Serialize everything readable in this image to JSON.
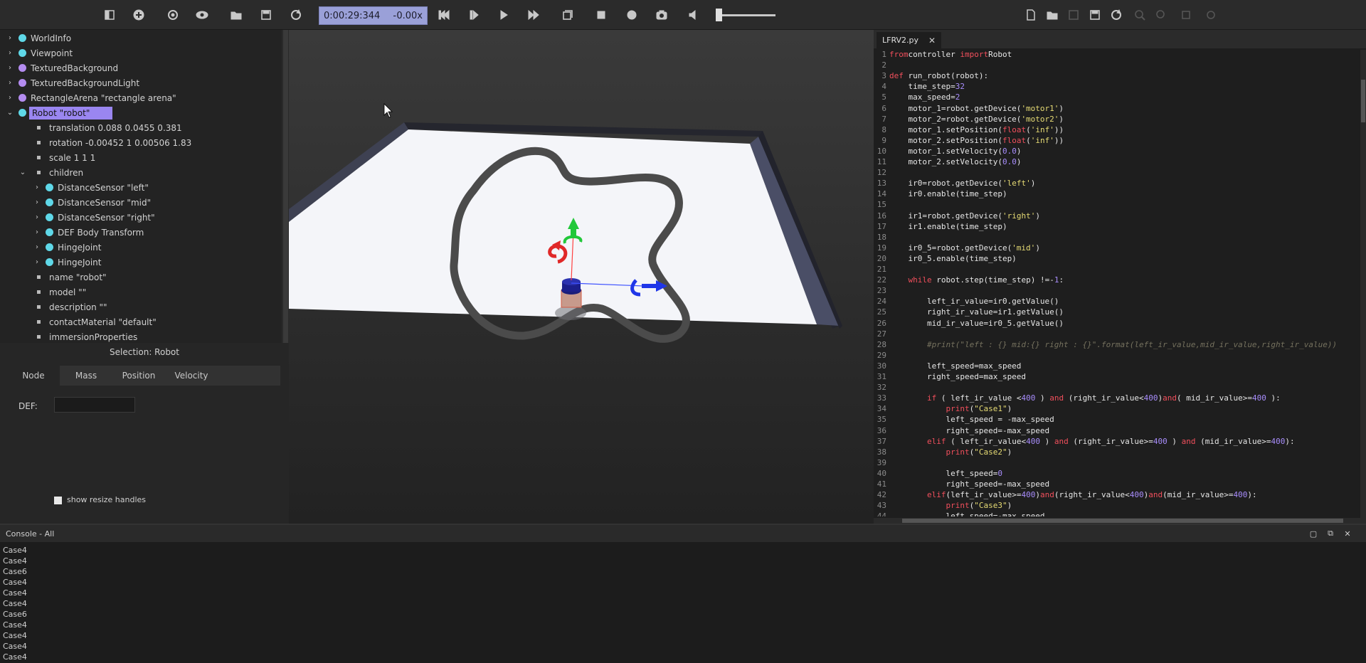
{
  "toolbar": {
    "time": "0:00:29:344",
    "separator": "-",
    "speed": "0.00x",
    "icons_left": [
      "scene-tree-toggle-icon",
      "add-node-icon",
      "reset-view-icon",
      "eye-icon",
      "open-world-icon",
      "save-world-icon",
      "reload-world-icon"
    ],
    "icons_sim": [
      "step-back-icon",
      "step-icon",
      "play-icon",
      "fast-forward-icon",
      "box-view-icon",
      "stop-recording-icon",
      "record-movie-icon",
      "screenshot-icon",
      "mute-icon"
    ],
    "icons_editor": [
      "new-file-icon",
      "open-file-icon",
      "save-file-icon",
      "save-as-icon",
      "revert-file-icon",
      "find-icon",
      "replace-icon",
      "build-icon",
      "clean-icon"
    ]
  },
  "scene_tree": {
    "items": [
      {
        "label": "WorldInfo",
        "depth": 0,
        "marker": "dot-cyan",
        "arrow": "›"
      },
      {
        "label": "Viewpoint",
        "depth": 0,
        "marker": "dot-cyan",
        "arrow": "›"
      },
      {
        "label": "TexturedBackground",
        "depth": 0,
        "marker": "dot-purple",
        "arrow": "›"
      },
      {
        "label": "TexturedBackgroundLight",
        "depth": 0,
        "marker": "dot-purple",
        "arrow": "›"
      },
      {
        "label": "RectangleArena \"rectangle arena\"",
        "depth": 0,
        "marker": "dot-purple",
        "arrow": "›"
      },
      {
        "label": "Robot \"robot\"",
        "depth": 0,
        "marker": "dot-cyan",
        "arrow": "⌄",
        "selected": true
      },
      {
        "label": "translation 0.088 0.0455 0.381",
        "depth": 1,
        "marker": "square",
        "arrow": ""
      },
      {
        "label": "rotation -0.00452 1 0.00506 1.83",
        "depth": 1,
        "marker": "square",
        "arrow": ""
      },
      {
        "label": "scale 1 1 1",
        "depth": 1,
        "marker": "square",
        "arrow": ""
      },
      {
        "label": "children",
        "depth": 1,
        "marker": "square",
        "arrow": "⌄"
      },
      {
        "label": "DistanceSensor \"left\"",
        "depth": 2,
        "marker": "dot-cyan",
        "arrow": "›"
      },
      {
        "label": "DistanceSensor \"mid\"",
        "depth": 2,
        "marker": "dot-cyan",
        "arrow": "›"
      },
      {
        "label": "DistanceSensor \"right\"",
        "depth": 2,
        "marker": "dot-cyan",
        "arrow": "›"
      },
      {
        "label": "DEF Body Transform",
        "depth": 2,
        "marker": "dot-cyan",
        "arrow": "›"
      },
      {
        "label": "HingeJoint",
        "depth": 2,
        "marker": "dot-cyan",
        "arrow": "›"
      },
      {
        "label": "HingeJoint",
        "depth": 2,
        "marker": "dot-cyan",
        "arrow": "›"
      },
      {
        "label": "name \"robot\"",
        "depth": 1,
        "marker": "square",
        "arrow": ""
      },
      {
        "label": "model \"\"",
        "depth": 1,
        "marker": "square",
        "arrow": ""
      },
      {
        "label": "description \"\"",
        "depth": 1,
        "marker": "square",
        "arrow": ""
      },
      {
        "label": "contactMaterial \"default\"",
        "depth": 1,
        "marker": "square",
        "arrow": ""
      },
      {
        "label": "immersionProperties",
        "depth": 1,
        "marker": "square",
        "arrow": ""
      }
    ]
  },
  "node_panel": {
    "selection": "Selection: Robot",
    "tabs": [
      "Node",
      "Mass",
      "Position",
      "Velocity"
    ],
    "active_tab": "Node",
    "def_label": "DEF:",
    "def_value": "",
    "resize_label": "show resize handles"
  },
  "editor": {
    "filename": "LFRV2.py",
    "close": "✕",
    "lines": [
      [
        [
          "kw",
          "from"
        ],
        [
          "",
          "controller "
        ],
        [
          "kw",
          "import"
        ],
        [
          "",
          "Robot"
        ]
      ],
      [],
      [
        [
          "kw",
          "def"
        ],
        [
          "",
          " run_robot(robot):"
        ]
      ],
      [
        [
          "",
          "    time_step="
        ],
        [
          "nm",
          "32"
        ]
      ],
      [
        [
          "",
          "    max_speed="
        ],
        [
          "nm",
          "2"
        ]
      ],
      [
        [
          "",
          "    motor_1=robot.getDevice("
        ],
        [
          "st",
          "'motor1'"
        ],
        [
          "",
          ")"
        ]
      ],
      [
        [
          "",
          "    motor_2=robot.getDevice("
        ],
        [
          "st",
          "'motor2'"
        ],
        [
          "",
          ")"
        ]
      ],
      [
        [
          "",
          "    motor_1.setPosition("
        ],
        [
          "bi",
          "float"
        ],
        [
          "",
          "("
        ],
        [
          "st",
          "'inf'"
        ],
        [
          "",
          "))"
        ]
      ],
      [
        [
          "",
          "    motor_2.setPosition("
        ],
        [
          "bi",
          "float"
        ],
        [
          "",
          "("
        ],
        [
          "st",
          "'inf'"
        ],
        [
          "",
          "))"
        ]
      ],
      [
        [
          "",
          "    motor_1.setVelocity("
        ],
        [
          "nm",
          "0.0"
        ],
        [
          "",
          ")"
        ]
      ],
      [
        [
          "",
          "    motor_2.setVelocity("
        ],
        [
          "nm",
          "0.0"
        ],
        [
          "",
          ")"
        ]
      ],
      [],
      [
        [
          "",
          "    ir0=robot.getDevice("
        ],
        [
          "st",
          "'left'"
        ],
        [
          "",
          ")"
        ]
      ],
      [
        [
          "",
          "    ir0.enable(time_step)"
        ]
      ],
      [],
      [
        [
          "",
          "    ir1=robot.getDevice("
        ],
        [
          "st",
          "'right'"
        ],
        [
          "",
          ")"
        ]
      ],
      [
        [
          "",
          "    ir1.enable(time_step)"
        ]
      ],
      [],
      [
        [
          "",
          "    ir0_5=robot.getDevice("
        ],
        [
          "st",
          "'mid'"
        ],
        [
          "",
          ")"
        ]
      ],
      [
        [
          "",
          "    ir0_5.enable(time_step)"
        ]
      ],
      [],
      [
        [
          "",
          "    "
        ],
        [
          "kw",
          "while"
        ],
        [
          "",
          " robot.step(time_step) !=-"
        ],
        [
          "nm",
          "1"
        ],
        [
          "",
          ":"
        ]
      ],
      [],
      [
        [
          "",
          "        left_ir_value=ir0.getValue()"
        ]
      ],
      [
        [
          "",
          "        right_ir_value=ir1.getValue()"
        ]
      ],
      [
        [
          "",
          "        mid_ir_value=ir0_5.getValue()"
        ]
      ],
      [],
      [
        [
          "cm",
          "        #print(\"left : {} mid:{} right : {}\".format(left_ir_value,mid_ir_value,right_ir_value))"
        ]
      ],
      [],
      [
        [
          "",
          "        left_speed=max_speed"
        ]
      ],
      [
        [
          "",
          "        right_speed=max_speed"
        ]
      ],
      [],
      [
        [
          "",
          "        "
        ],
        [
          "kw",
          "if"
        ],
        [
          "",
          " ( left_ir_value <"
        ],
        [
          "nm",
          "400"
        ],
        [
          "",
          " ) "
        ],
        [
          "kw",
          "and"
        ],
        [
          "",
          " (right_ir_value<"
        ],
        [
          "nm",
          "400"
        ],
        [
          "",
          ")"
        ],
        [
          "kw",
          "and"
        ],
        [
          "",
          "( mid_ir_value>="
        ],
        [
          "nm",
          "400"
        ],
        [
          "",
          " ):"
        ]
      ],
      [
        [
          "",
          "            "
        ],
        [
          "bi",
          "print"
        ],
        [
          "",
          "("
        ],
        [
          "st",
          "\"Case1\""
        ],
        [
          "",
          ")"
        ]
      ],
      [
        [
          "",
          "            left_speed = -max_speed"
        ]
      ],
      [
        [
          "",
          "            right_speed=-max_speed"
        ]
      ],
      [
        [
          "",
          "        "
        ],
        [
          "kw",
          "elif"
        ],
        [
          "",
          " ( left_ir_value<"
        ],
        [
          "nm",
          "400"
        ],
        [
          "",
          " ) "
        ],
        [
          "kw",
          "and"
        ],
        [
          "",
          " (right_ir_value>="
        ],
        [
          "nm",
          "400"
        ],
        [
          "",
          " ) "
        ],
        [
          "kw",
          "and"
        ],
        [
          "",
          " (mid_ir_value>="
        ],
        [
          "nm",
          "400"
        ],
        [
          "",
          "):"
        ]
      ],
      [
        [
          "",
          "            "
        ],
        [
          "bi",
          "print"
        ],
        [
          "",
          "("
        ],
        [
          "st",
          "\"Case2\""
        ],
        [
          "",
          ")"
        ]
      ],
      [],
      [
        [
          "",
          "            left_speed="
        ],
        [
          "nm",
          "0"
        ]
      ],
      [
        [
          "",
          "            right_speed=-max_speed"
        ]
      ],
      [
        [
          "",
          "        "
        ],
        [
          "kw",
          "elif"
        ],
        [
          "",
          "(left_ir_value>="
        ],
        [
          "nm",
          "400"
        ],
        [
          "",
          ")"
        ],
        [
          "kw",
          "and"
        ],
        [
          "",
          "(right_ir_value<"
        ],
        [
          "nm",
          "400"
        ],
        [
          "",
          ")"
        ],
        [
          "kw",
          "and"
        ],
        [
          "",
          "(mid_ir_value>="
        ],
        [
          "nm",
          "400"
        ],
        [
          "",
          "):"
        ]
      ],
      [
        [
          "",
          "            "
        ],
        [
          "bi",
          "print"
        ],
        [
          "",
          "("
        ],
        [
          "st",
          "\"Case3\""
        ],
        [
          "",
          ")"
        ]
      ],
      [
        [
          "",
          "            left_speed=-max_speed"
        ]
      ]
    ]
  },
  "console": {
    "title": "Console - All",
    "lines": [
      "Case4",
      "Case4",
      "Case6",
      "Case4",
      "Case4",
      "Case4",
      "Case6",
      "Case4",
      "Case4",
      "Case4",
      "Case4"
    ]
  }
}
